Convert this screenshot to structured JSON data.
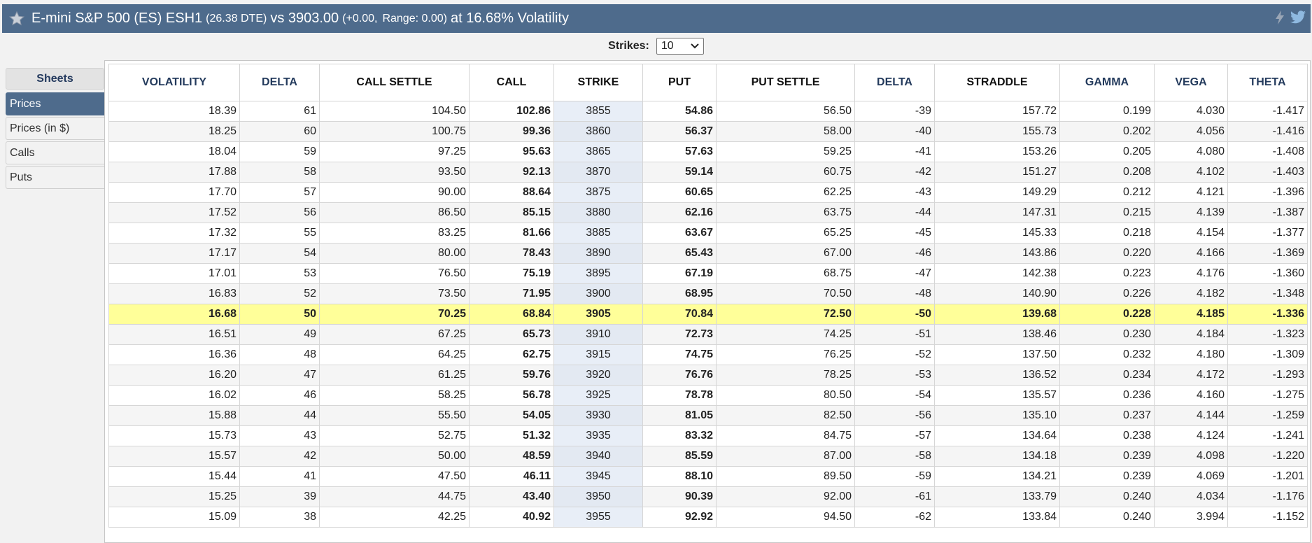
{
  "header": {
    "title_main": "E-mini S&P 500 (ES) ESH1",
    "dte": "(26.38 DTE)",
    "vs": "vs 3903.00",
    "change": "(+0.00,",
    "range": "Range: 0.00)",
    "volatility": "at 16.68% Volatility",
    "icons": [
      "star-icon",
      "lightning-icon",
      "twitter-icon"
    ]
  },
  "strikes": {
    "label": "Strikes:",
    "value": "10"
  },
  "sidebar": {
    "heading": "Sheets",
    "items": [
      {
        "label": "Prices",
        "active": true
      },
      {
        "label": "Prices (in $)",
        "active": false
      },
      {
        "label": "Calls",
        "active": false
      },
      {
        "label": "Puts",
        "active": false
      }
    ]
  },
  "table": {
    "columns": [
      "VOLATILITY",
      "DELTA",
      "CALL SETTLE",
      "CALL",
      "STRIKE",
      "PUT",
      "PUT SETTLE",
      "DELTA",
      "STRADDLE",
      "GAMMA",
      "VEGA",
      "THETA"
    ],
    "rows": [
      [
        "18.39",
        "61",
        "104.50",
        "102.86",
        "3855",
        "54.86",
        "56.50",
        "-39",
        "157.72",
        "0.199",
        "4.030",
        "-1.417"
      ],
      [
        "18.25",
        "60",
        "100.75",
        "99.36",
        "3860",
        "56.37",
        "58.00",
        "-40",
        "155.73",
        "0.202",
        "4.056",
        "-1.416"
      ],
      [
        "18.04",
        "59",
        "97.25",
        "95.63",
        "3865",
        "57.63",
        "59.25",
        "-41",
        "153.26",
        "0.205",
        "4.080",
        "-1.408"
      ],
      [
        "17.88",
        "58",
        "93.50",
        "92.13",
        "3870",
        "59.14",
        "60.75",
        "-42",
        "151.27",
        "0.208",
        "4.102",
        "-1.403"
      ],
      [
        "17.70",
        "57",
        "90.00",
        "88.64",
        "3875",
        "60.65",
        "62.25",
        "-43",
        "149.29",
        "0.212",
        "4.121",
        "-1.396"
      ],
      [
        "17.52",
        "56",
        "86.50",
        "85.15",
        "3880",
        "62.16",
        "63.75",
        "-44",
        "147.31",
        "0.215",
        "4.139",
        "-1.387"
      ],
      [
        "17.32",
        "55",
        "83.25",
        "81.66",
        "3885",
        "63.67",
        "65.25",
        "-45",
        "145.33",
        "0.218",
        "4.154",
        "-1.377"
      ],
      [
        "17.17",
        "54",
        "80.00",
        "78.43",
        "3890",
        "65.43",
        "67.00",
        "-46",
        "143.86",
        "0.220",
        "4.166",
        "-1.369"
      ],
      [
        "17.01",
        "53",
        "76.50",
        "75.19",
        "3895",
        "67.19",
        "68.75",
        "-47",
        "142.38",
        "0.223",
        "4.176",
        "-1.360"
      ],
      [
        "16.83",
        "52",
        "73.50",
        "71.95",
        "3900",
        "68.95",
        "70.50",
        "-48",
        "140.90",
        "0.226",
        "4.182",
        "-1.348"
      ],
      [
        "16.68",
        "50",
        "70.25",
        "68.84",
        "3905",
        "70.84",
        "72.50",
        "-50",
        "139.68",
        "0.228",
        "4.185",
        "-1.336"
      ],
      [
        "16.51",
        "49",
        "67.25",
        "65.73",
        "3910",
        "72.73",
        "74.25",
        "-51",
        "138.46",
        "0.230",
        "4.184",
        "-1.323"
      ],
      [
        "16.36",
        "48",
        "64.25",
        "62.75",
        "3915",
        "74.75",
        "76.25",
        "-52",
        "137.50",
        "0.232",
        "4.180",
        "-1.309"
      ],
      [
        "16.20",
        "47",
        "61.25",
        "59.76",
        "3920",
        "76.76",
        "78.25",
        "-53",
        "136.52",
        "0.234",
        "4.172",
        "-1.293"
      ],
      [
        "16.02",
        "46",
        "58.25",
        "56.78",
        "3925",
        "78.78",
        "80.50",
        "-54",
        "135.57",
        "0.236",
        "4.160",
        "-1.275"
      ],
      [
        "15.88",
        "44",
        "55.50",
        "54.05",
        "3930",
        "81.05",
        "82.50",
        "-56",
        "135.10",
        "0.237",
        "4.144",
        "-1.259"
      ],
      [
        "15.73",
        "43",
        "52.75",
        "51.32",
        "3935",
        "83.32",
        "84.75",
        "-57",
        "134.64",
        "0.238",
        "4.124",
        "-1.241"
      ],
      [
        "15.57",
        "42",
        "50.00",
        "48.59",
        "3940",
        "85.59",
        "87.00",
        "-58",
        "134.18",
        "0.239",
        "4.098",
        "-1.220"
      ],
      [
        "15.44",
        "41",
        "47.50",
        "46.11",
        "3945",
        "88.10",
        "89.50",
        "-59",
        "134.21",
        "0.239",
        "4.069",
        "-1.201"
      ],
      [
        "15.25",
        "39",
        "44.75",
        "43.40",
        "3950",
        "90.39",
        "92.00",
        "-61",
        "133.79",
        "0.240",
        "4.034",
        "-1.176"
      ],
      [
        "15.09",
        "38",
        "42.25",
        "40.92",
        "3955",
        "92.92",
        "94.50",
        "-62",
        "133.84",
        "0.240",
        "3.994",
        "-1.152"
      ]
    ],
    "atm_row_index": 10
  },
  "colors": {
    "header_bg": "#4e6b8c",
    "atm_highlight": "#ffff99",
    "strike_bg": "#e8eef7"
  }
}
